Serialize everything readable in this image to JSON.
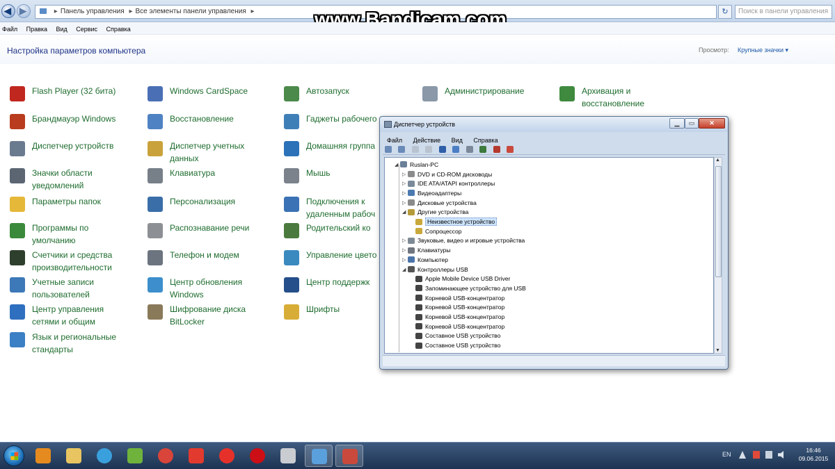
{
  "address_bar": {
    "path": [
      "Панель управления",
      "Все элементы панели управления"
    ],
    "search_placeholder": "Поиск в панели управления"
  },
  "watermark": "www.Bandicam.com",
  "menu": [
    "Файл",
    "Правка",
    "Вид",
    "Сервис",
    "Справка"
  ],
  "header": {
    "title": "Настройка параметров компьютера",
    "view_label": "Просмотр:",
    "view_value": "Крупные значки ▾"
  },
  "columns": [
    [
      {
        "label": "Flash Player (32 бита)",
        "icon": "flash-icon",
        "color": "#c0271e"
      },
      {
        "label": "Брандмауэр Windows",
        "icon": "firewall-icon",
        "color": "#b83c1d"
      },
      {
        "label": "Диспетчер устройств",
        "icon": "device-manager-icon",
        "color": "#6b7b8f"
      },
      {
        "label": "Значки области\nуведомлений",
        "icon": "notification-icons-icon",
        "color": "#5c6673"
      },
      {
        "label": "Параметры папок",
        "icon": "folder-options-icon",
        "color": "#e5b83a"
      },
      {
        "label": "Программы по\nумолчанию",
        "icon": "default-programs-icon",
        "color": "#3b8a3b"
      },
      {
        "label": "Счетчики и средства\nпроизводительности",
        "icon": "performance-icon",
        "color": "#2e3f2e"
      },
      {
        "label": "Учетные записи\nпользователей",
        "icon": "user-accounts-icon",
        "color": "#3d78b8"
      },
      {
        "label": "Центр управления\nсетями и общим",
        "icon": "network-center-icon",
        "color": "#2f6fbf"
      },
      {
        "label": "Язык и региональные\nстандарты",
        "icon": "region-icon",
        "color": "#3b7fc4"
      }
    ],
    [
      {
        "label": "Windows CardSpace",
        "icon": "cardspace-icon",
        "color": "#4a6fb5"
      },
      {
        "label": "Восстановление",
        "icon": "recovery-icon",
        "color": "#4f82c2"
      },
      {
        "label": "Диспетчер учетных\nданных",
        "icon": "credential-manager-icon",
        "color": "#c9a23b"
      },
      {
        "label": "Клавиатура",
        "icon": "keyboard-icon",
        "color": "#777f88"
      },
      {
        "label": "Персонализация",
        "icon": "personalization-icon",
        "color": "#3a6ea8"
      },
      {
        "label": "Распознавание речи",
        "icon": "speech-icon",
        "color": "#8c8f94"
      },
      {
        "label": "Телефон и модем",
        "icon": "phone-modem-icon",
        "color": "#6c747f"
      },
      {
        "label": "Центр обновления\nWindows",
        "icon": "windows-update-icon",
        "color": "#3c8fcc"
      },
      {
        "label": "Шифрование диска\nBitLocker",
        "icon": "bitlocker-icon",
        "color": "#8a7a5a"
      }
    ],
    [
      {
        "label": "Автозапуск",
        "icon": "autoplay-icon",
        "color": "#4c8a4c"
      },
      {
        "label": "Гаджеты рабочего",
        "icon": "gadgets-icon",
        "color": "#3f7fb8"
      },
      {
        "label": "Домашняя группа",
        "icon": "homegroup-icon",
        "color": "#2c72b8"
      },
      {
        "label": "Мышь",
        "icon": "mouse-icon",
        "color": "#7b828b"
      },
      {
        "label": "Подключения к\nудаленным рабоч",
        "icon": "remote-desktop-icon",
        "color": "#3b72b5"
      },
      {
        "label": "Родительский ко",
        "icon": "parental-control-icon",
        "color": "#4a7a3d"
      },
      {
        "label": "Управление цвето",
        "icon": "color-management-icon",
        "color": "#3a8abf"
      },
      {
        "label": "Центр поддержк",
        "icon": "action-center-icon",
        "color": "#254f8a"
      },
      {
        "label": "Шрифты",
        "icon": "fonts-icon",
        "color": "#d8ad37"
      }
    ],
    [
      {
        "label": "Администрирование",
        "icon": "admin-tools-icon",
        "color": "#8a98a8"
      }
    ],
    [
      {
        "label": "Архивация и\nвосстановление",
        "icon": "backup-icon",
        "color": "#3f8a3f"
      }
    ]
  ],
  "device_manager": {
    "title": "Диспетчер устройств",
    "menu": [
      "Файл",
      "Действие",
      "Вид",
      "Справка"
    ],
    "tree": [
      {
        "level": 0,
        "exp": "◢",
        "label": "Ruslan-PC",
        "icon_color": "#6a7f98"
      },
      {
        "level": 1,
        "exp": "▷",
        "label": "DVD и CD-ROM дисководы",
        "icon_color": "#8b8b8b"
      },
      {
        "level": 1,
        "exp": "▷",
        "label": "IDE ATA/ATAPI контроллеры",
        "icon_color": "#7a8a9a"
      },
      {
        "level": 1,
        "exp": "▷",
        "label": "Видеоадаптеры",
        "icon_color": "#4b7ab0"
      },
      {
        "level": 1,
        "exp": "▷",
        "label": "Дисковые устройства",
        "icon_color": "#8a8a8a"
      },
      {
        "level": 1,
        "exp": "◢",
        "label": "Другие устройства",
        "icon_color": "#b59a3a"
      },
      {
        "level": 2,
        "exp": "",
        "label": "Неизвестное устройство",
        "icon_color": "#c9a83b",
        "selected": true
      },
      {
        "level": 2,
        "exp": "",
        "label": "Сопроцессор",
        "icon_color": "#c9a83b"
      },
      {
        "level": 1,
        "exp": "▷",
        "label": "Звуковые, видео и игровые устройства",
        "icon_color": "#7d8a96"
      },
      {
        "level": 1,
        "exp": "▷",
        "label": "Клавиатуры",
        "icon_color": "#6f767f"
      },
      {
        "level": 1,
        "exp": "▷",
        "label": "Компьютер",
        "icon_color": "#4a74aa"
      },
      {
        "level": 1,
        "exp": "◢",
        "label": "Контроллеры USB",
        "icon_color": "#555"
      },
      {
        "level": 2,
        "exp": "",
        "label": "Apple Mobile Device USB Driver",
        "icon_color": "#444"
      },
      {
        "level": 2,
        "exp": "",
        "label": "Запоминающее устройство для USB",
        "icon_color": "#444"
      },
      {
        "level": 2,
        "exp": "",
        "label": "Корневой USB-концентратор",
        "icon_color": "#444"
      },
      {
        "level": 2,
        "exp": "",
        "label": "Корневой USB-концентратор",
        "icon_color": "#444"
      },
      {
        "level": 2,
        "exp": "",
        "label": "Корневой USB-концентратор",
        "icon_color": "#444"
      },
      {
        "level": 2,
        "exp": "",
        "label": "Корневой USB-концентратор",
        "icon_color": "#444"
      },
      {
        "level": 2,
        "exp": "",
        "label": "Составное USB устройство",
        "icon_color": "#444"
      },
      {
        "level": 2,
        "exp": "",
        "label": "Составное USB устройство",
        "icon_color": "#444"
      }
    ]
  },
  "taskbar": {
    "apps": [
      {
        "name": "media-player",
        "color": "#e58a1f"
      },
      {
        "name": "explorer",
        "color": "#e8c561"
      },
      {
        "name": "skype",
        "color": "#3aa0dd"
      },
      {
        "name": "utorrent",
        "color": "#6fb33d"
      },
      {
        "name": "chrome",
        "color": "#d9453a"
      },
      {
        "name": "yandex",
        "color": "#e23a2e"
      },
      {
        "name": "yandex-browser",
        "color": "#e6312a"
      },
      {
        "name": "opera",
        "color": "#cc0f16"
      },
      {
        "name": "notepad",
        "color": "#c9ccd1"
      },
      {
        "name": "control-panel",
        "color": "#5aa0dc"
      },
      {
        "name": "device-manager",
        "color": "#c94a3c"
      }
    ],
    "lang": "EN",
    "time": "16:46",
    "date": "09.06.2015"
  }
}
